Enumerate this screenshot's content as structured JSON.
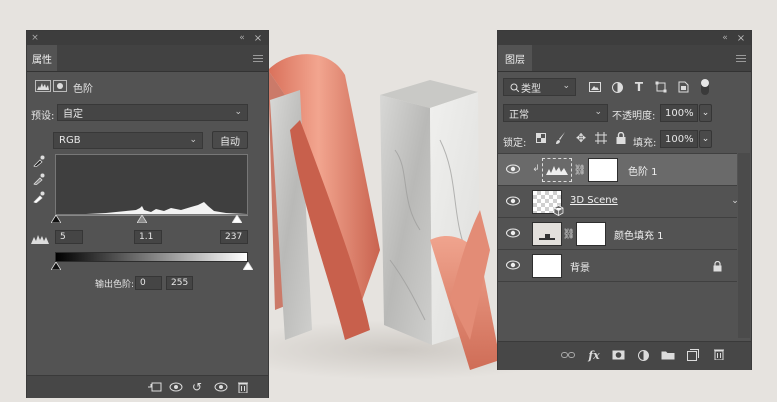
{
  "properties_panel": {
    "tab_label": "属性",
    "adjustment_title": "色阶",
    "preset_label": "预设:",
    "preset_value": "自定",
    "channel_value": "RGB",
    "auto_button": "自动",
    "input_shadow": "5",
    "input_midtone": "1.1",
    "input_highlight": "237",
    "output_label": "输出色阶:",
    "output_black": "0",
    "output_white": "255"
  },
  "layers_panel": {
    "tab_label": "图层",
    "filter_kind": "类型",
    "blend_mode": "正常",
    "opacity_label": "不透明度:",
    "opacity_value": "100%",
    "lock_label": "锁定:",
    "fill_label": "填充:",
    "fill_value": "100%",
    "layers": [
      {
        "name": "色阶 1",
        "selected": true
      },
      {
        "name": "3D Scene",
        "selected": false
      },
      {
        "name": "颜色填充 1",
        "selected": false
      },
      {
        "name": "背景",
        "selected": false
      }
    ]
  },
  "icons": {
    "accent_copper": "#e8937c",
    "panel_bg": "#535353"
  }
}
